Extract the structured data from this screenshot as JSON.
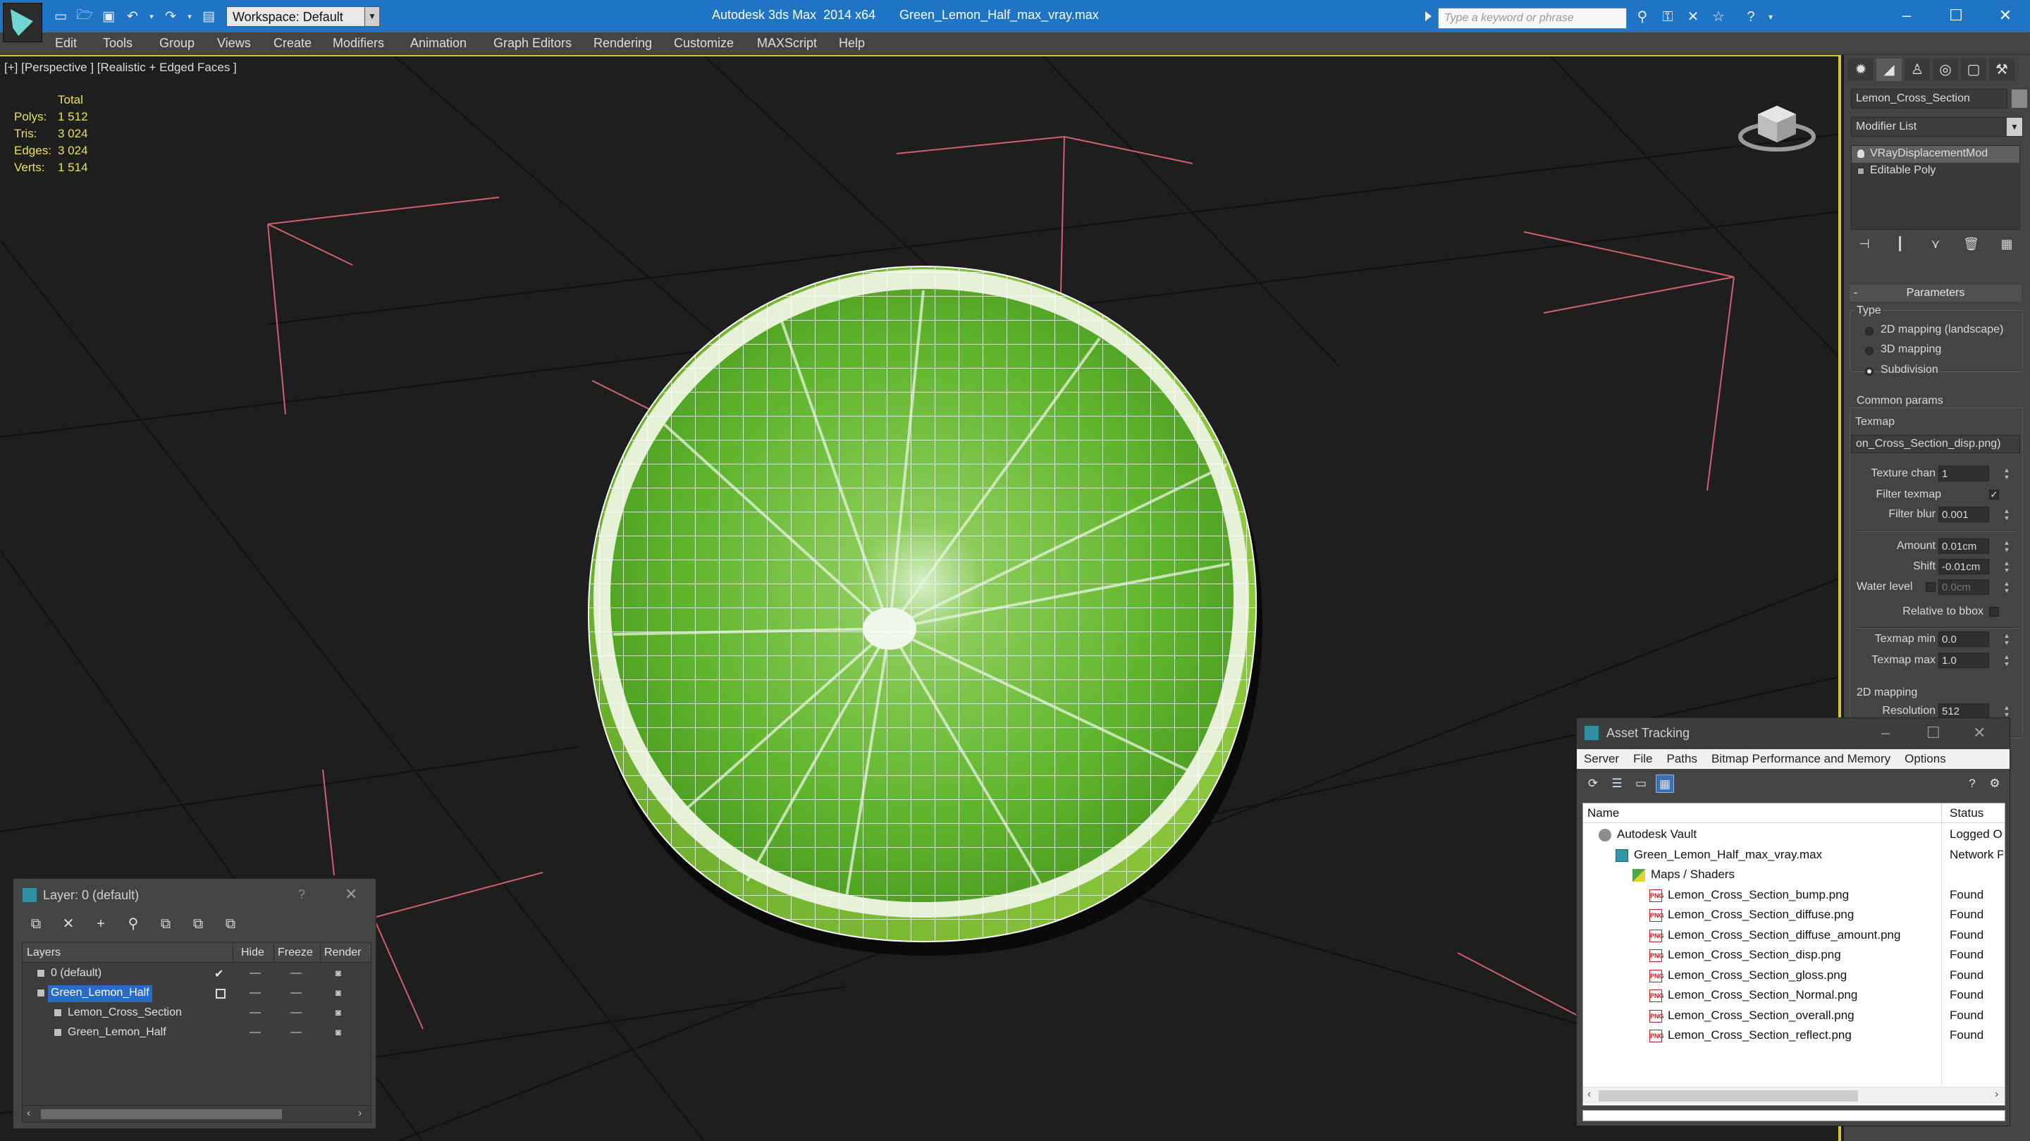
{
  "titlebar": {
    "app_title": "Autodesk 3ds Max  2014 x64",
    "file_title": "Green_Lemon_Half_max_vray.max",
    "workspace": "Workspace: Default",
    "search_placeholder": "Type a keyword or phrase"
  },
  "menu": [
    "Edit",
    "Tools",
    "Group",
    "Views",
    "Create",
    "Modifiers",
    "Animation",
    "Graph Editors",
    "Rendering",
    "Customize",
    "MAXScript",
    "Help"
  ],
  "viewport": {
    "label": "[+] [Perspective ] [Realistic + Edged Faces ]",
    "stats_header": "Total",
    "stats": [
      {
        "key": "Polys:",
        "value": "1 512"
      },
      {
        "key": "Tris:",
        "value": "3 024"
      },
      {
        "key": "Edges:",
        "value": "3 024"
      },
      {
        "key": "Verts:",
        "value": "1 514"
      }
    ]
  },
  "command_panel": {
    "object_name": "Lemon_Cross_Section",
    "modifier_list": "Modifier List",
    "stack": [
      "VRayDisplacementMod",
      "Editable Poly"
    ],
    "rollout_title": "Parameters",
    "type_label": "Type",
    "type_options": [
      "2D mapping (landscape)",
      "3D mapping",
      "Subdivision"
    ],
    "type_selected": "Subdivision",
    "common_params": "Common params",
    "texmap_label": "Texmap",
    "texmap_value": "on_Cross_Section_disp.png)",
    "texture_chan_label": "Texture chan",
    "texture_chan": "1",
    "filter_texmap_label": "Filter texmap",
    "filter_blur_label": "Filter blur",
    "filter_blur": "0.001",
    "amount_label": "Amount",
    "amount": "0.01cm",
    "shift_label": "Shift",
    "shift": "-0.01cm",
    "water_level_label": "Water level",
    "water_level": "0.0cm",
    "relative_bbox_label": "Relative to bbox",
    "texmap_min_label": "Texmap min",
    "texmap_min": "0.0",
    "texmap_max_label": "Texmap max",
    "texmap_max": "1.0",
    "mapping_2d": "2D mapping",
    "resolution_label": "Resolution",
    "resolution": "512"
  },
  "asset_tracking": {
    "title": "Asset Tracking",
    "menu": [
      "Server",
      "File",
      "Paths",
      "Bitmap Performance and Memory",
      "Options"
    ],
    "col_name": "Name",
    "col_status": "Status",
    "rows": [
      {
        "name": "Autodesk Vault",
        "status": "Logged Out",
        "indent": 0,
        "icon": "vault-icon"
      },
      {
        "name": "Green_Lemon_Half_max_vray.max",
        "status": "Network Path",
        "indent": 1,
        "icon": "max-file-icon"
      },
      {
        "name": "Maps / Shaders",
        "status": "",
        "indent": 2,
        "icon": "maps-icon"
      },
      {
        "name": "Lemon_Cross_Section_bump.png",
        "status": "Found",
        "indent": 3,
        "icon": "png-icon"
      },
      {
        "name": "Lemon_Cross_Section_diffuse.png",
        "status": "Found",
        "indent": 3,
        "icon": "png-icon"
      },
      {
        "name": "Lemon_Cross_Section_diffuse_amount.png",
        "status": "Found",
        "indent": 3,
        "icon": "png-icon"
      },
      {
        "name": "Lemon_Cross_Section_disp.png",
        "status": "Found",
        "indent": 3,
        "icon": "png-icon"
      },
      {
        "name": "Lemon_Cross_Section_gloss.png",
        "status": "Found",
        "indent": 3,
        "icon": "png-icon"
      },
      {
        "name": "Lemon_Cross_Section_Normal.png",
        "status": "Found",
        "indent": 3,
        "icon": "png-icon"
      },
      {
        "name": "Lemon_Cross_Section_overall.png",
        "status": "Found",
        "indent": 3,
        "icon": "png-icon"
      },
      {
        "name": "Lemon_Cross_Section_reflect.png",
        "status": "Found",
        "indent": 3,
        "icon": "png-icon"
      }
    ]
  },
  "layer_explorer": {
    "title": "Layer: 0 (default)",
    "help": "?",
    "columns": [
      "Layers",
      "Hide",
      "Freeze",
      "Render"
    ],
    "rows": [
      {
        "name": "0 (default)",
        "indent": 0,
        "selected": false
      },
      {
        "name": "Green_Lemon_Half",
        "indent": 0,
        "selected": true
      },
      {
        "name": "Lemon_Cross_Section",
        "indent": 1,
        "selected": false
      },
      {
        "name": "Green_Lemon_Half",
        "indent": 1,
        "selected": false
      }
    ]
  },
  "colors": {
    "titlebar": "#1f74c6",
    "viewport_border": "#d9c431",
    "stats_text": "#e7e25a",
    "selection": "#2a6bc8",
    "lime_green": "#6fbf2a"
  }
}
